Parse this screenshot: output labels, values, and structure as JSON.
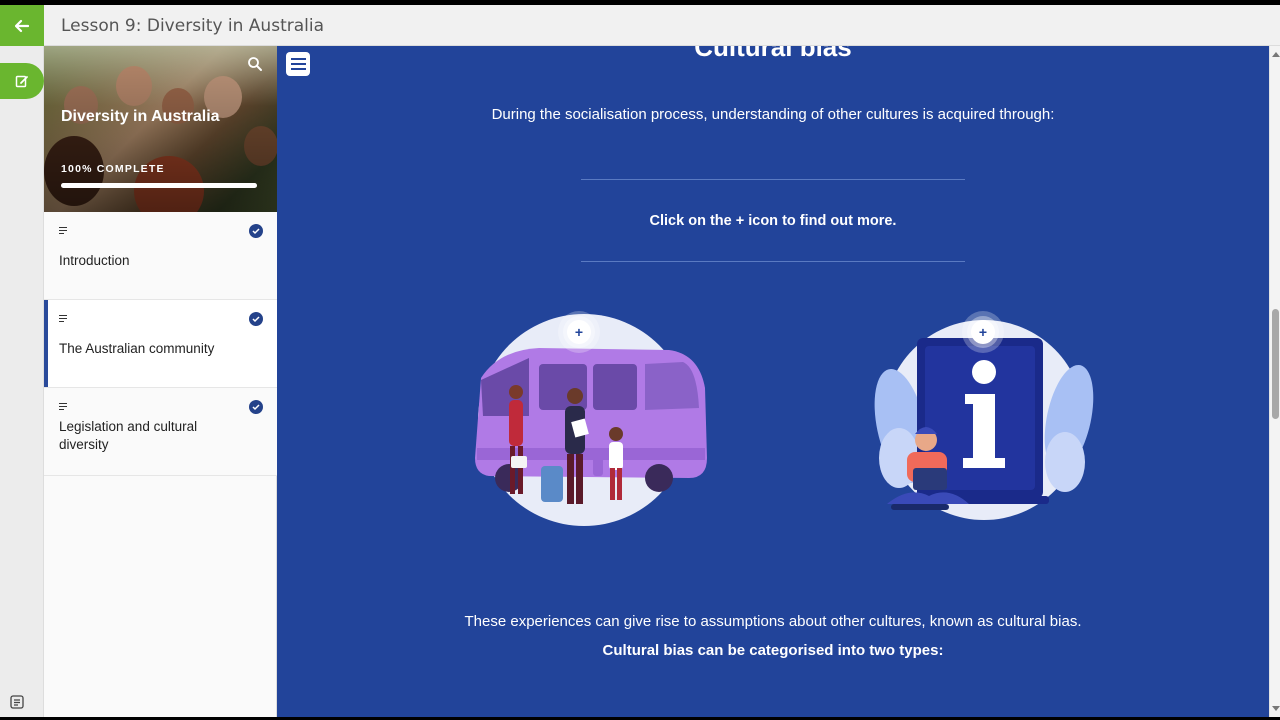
{
  "header": {
    "lesson_title": "Lesson 9: Diversity in Australia",
    "back_icon": "arrow-left-icon"
  },
  "rail": {
    "note_icon": "edit-note-icon",
    "bottom_icon": "notes-icon"
  },
  "sidebar": {
    "course_title": "Diversity in Australia",
    "progress_label": "100% COMPLETE",
    "progress_percent": 100,
    "items": [
      {
        "label": "Introduction",
        "completed": true,
        "active": false
      },
      {
        "label": "The Australian community",
        "completed": true,
        "active": true
      },
      {
        "label": "Legislation and cultural diversity",
        "completed": true,
        "active": false
      }
    ]
  },
  "main": {
    "heading": "Cultural bias",
    "intro": "During the socialisation process, understanding of other cultures is acquired through:",
    "instruction": "Click on the + icon to find out more.",
    "hotspots": [
      {
        "plus": "+",
        "illustration": "travel-bus-icon"
      },
      {
        "plus": "+",
        "illustration": "information-icon"
      }
    ],
    "bottom_text_plain": "These experiences can give rise to assumptions about other cultures, known as cultural bias.",
    "bottom_text_bold": "Cultural bias can be categorised into two types:"
  },
  "colors": {
    "accent_green": "#6ab62f",
    "main_blue": "#22449a",
    "check_blue": "#24428a"
  }
}
